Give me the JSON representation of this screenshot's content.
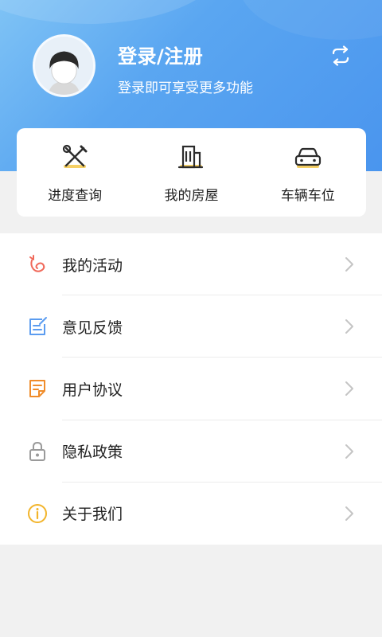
{
  "header": {
    "title": "登录/注册",
    "subtitle": "登录即可享受更多功能",
    "avatar_icon": "default-avatar-icon",
    "switch_icon": "switch-account-icon"
  },
  "quick_actions": [
    {
      "label": "进度查询",
      "icon": "tools-icon"
    },
    {
      "label": "我的房屋",
      "icon": "building-icon"
    },
    {
      "label": "车辆车位",
      "icon": "car-icon"
    }
  ],
  "menu": [
    {
      "label": "我的活动",
      "icon": "activity-icon",
      "color": "#f0695a"
    },
    {
      "label": "意见反馈",
      "icon": "feedback-icon",
      "color": "#5b9cf0"
    },
    {
      "label": "用户协议",
      "icon": "agreement-icon",
      "color": "#f08c2a"
    },
    {
      "label": "隐私政策",
      "icon": "lock-icon",
      "color": "#9a9a9a"
    },
    {
      "label": "关于我们",
      "icon": "info-icon",
      "color": "#f2b42a"
    }
  ],
  "colors": {
    "header_start": "#7fc3f5",
    "header_end": "#4a95ee",
    "accent_yellow": "#f5c84a"
  }
}
